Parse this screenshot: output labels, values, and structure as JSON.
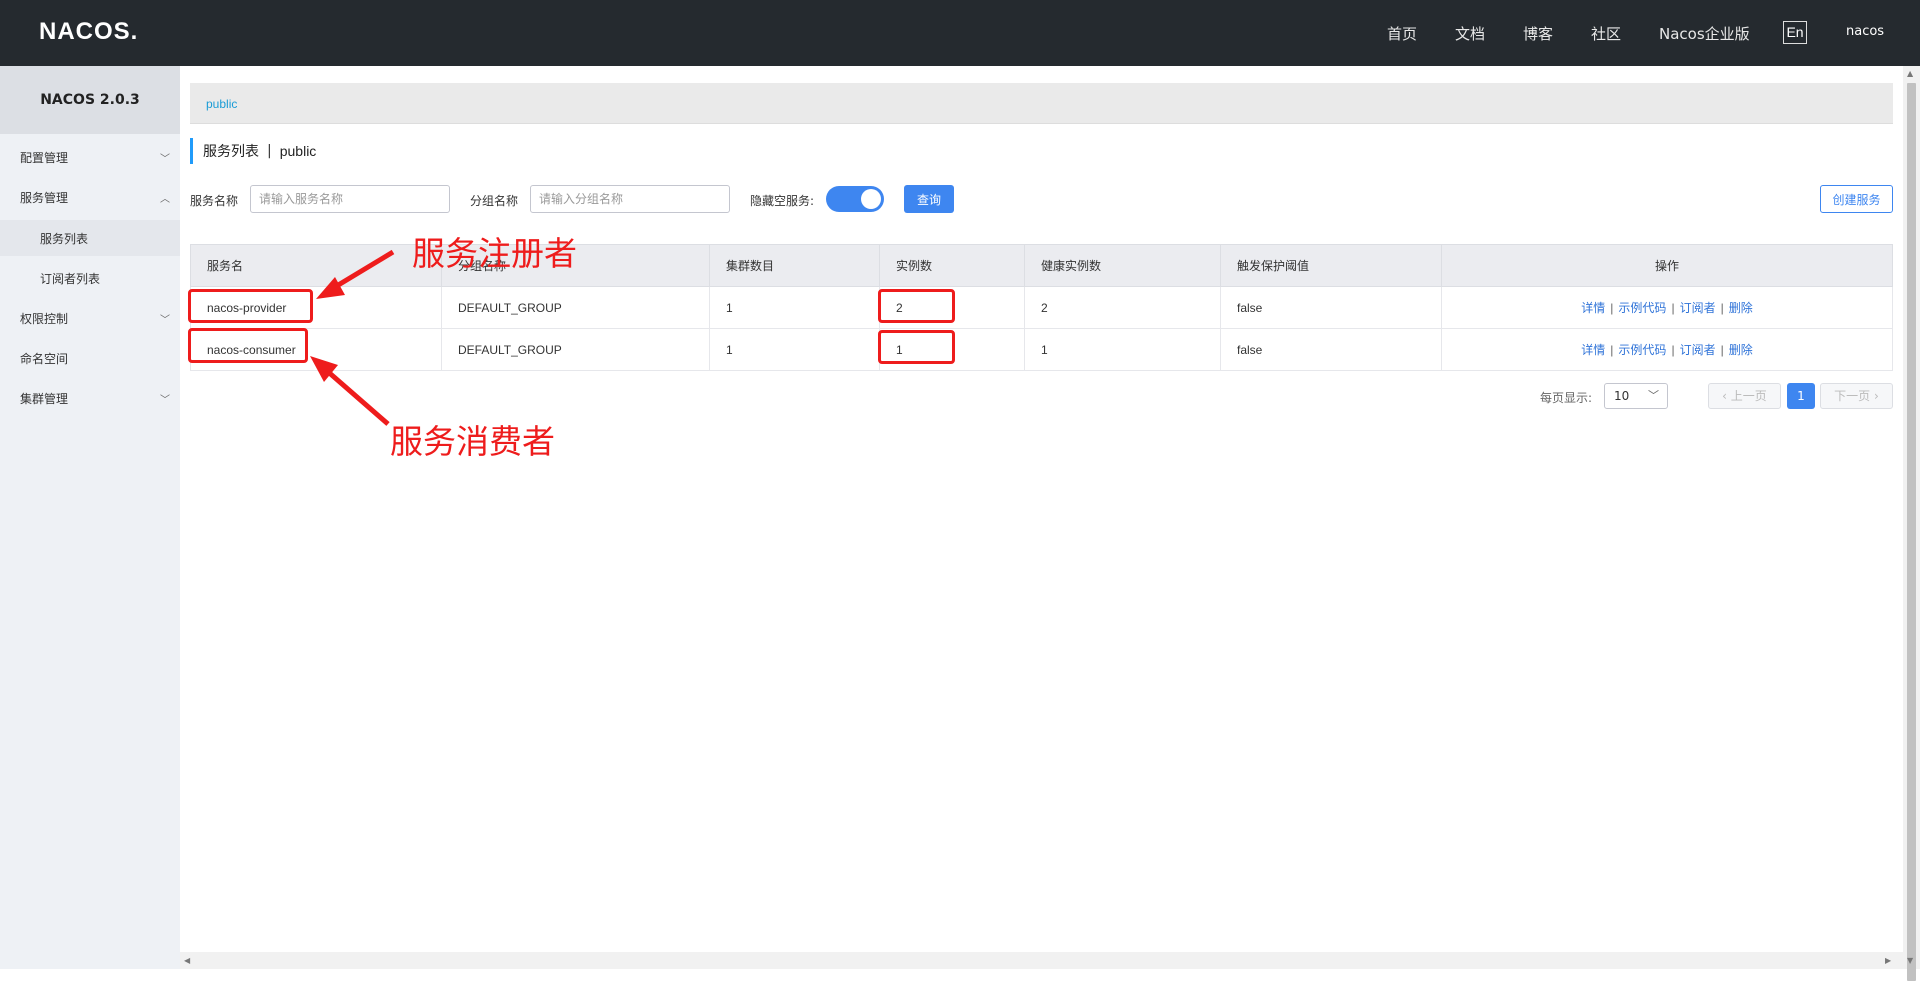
{
  "header": {
    "logo": "NACOS.",
    "nav": [
      "首页",
      "文档",
      "博客",
      "社区",
      "Nacos企业版"
    ],
    "lang": "En",
    "user": "nacos"
  },
  "sidebar": {
    "version": "NACOS 2.0.3",
    "items": [
      {
        "label": "配置管理",
        "expanded": false
      },
      {
        "label": "服务管理",
        "expanded": true
      },
      {
        "label": "服务列表",
        "sub": true,
        "active": true
      },
      {
        "label": "订阅者列表",
        "sub": true
      },
      {
        "label": "权限控制",
        "expanded": false
      },
      {
        "label": "命名空间"
      },
      {
        "label": "集群管理",
        "expanded": false
      }
    ]
  },
  "breadcrumb": "public",
  "page": {
    "title": "服务列表",
    "namespace": "public"
  },
  "filters": {
    "service_label": "服务名称",
    "service_placeholder": "请输入服务名称",
    "group_label": "分组名称",
    "group_placeholder": "请输入分组名称",
    "hide_empty_label": "隐藏空服务:",
    "hide_empty_on": true,
    "query_button": "查询",
    "create_button": "创建服务"
  },
  "table": {
    "columns": [
      "服务名",
      "分组名称",
      "集群数目",
      "实例数",
      "健康实例数",
      "触发保护阈值",
      "操作"
    ],
    "rows": [
      {
        "name": "nacos-provider",
        "group": "DEFAULT_GROUP",
        "clusters": "1",
        "instances": "2",
        "healthy": "2",
        "protect": "false"
      },
      {
        "name": "nacos-consumer",
        "group": "DEFAULT_GROUP",
        "clusters": "1",
        "instances": "1",
        "healthy": "1",
        "protect": "false"
      }
    ],
    "ops": [
      "详情",
      "示例代码",
      "订阅者",
      "删除"
    ]
  },
  "pagination": {
    "per_page_label": "每页显示:",
    "per_page": "10",
    "prev": "上一页",
    "current": "1",
    "next": "下一页"
  },
  "annotations": {
    "provider": "服务注册者",
    "consumer": "服务消费者",
    "color": "#ee1c1c"
  }
}
